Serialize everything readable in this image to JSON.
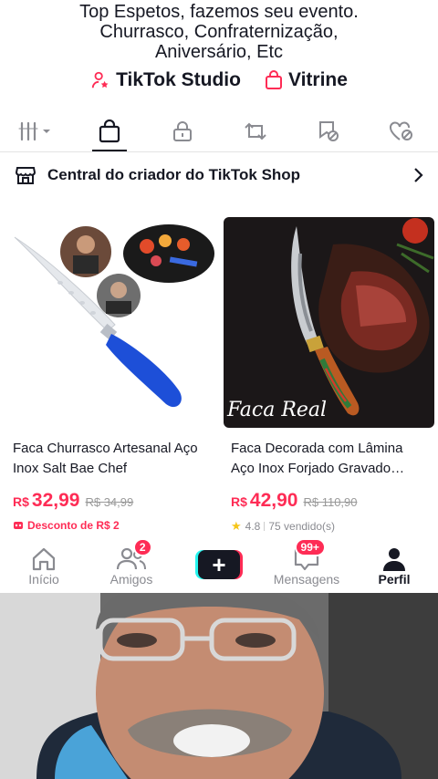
{
  "profile": {
    "bio_lines": [
      "Top Espetos, fazemos seu evento.",
      "Churrasco, Confraternização,",
      "Aniversário, Etc"
    ],
    "links": [
      {
        "icon": "person-star-icon",
        "label": "TikTok Studio"
      },
      {
        "icon": "shopping-bag-icon",
        "label": "Vitrine"
      }
    ]
  },
  "tabs": [
    {
      "icon": "grid-icon",
      "active": false
    },
    {
      "icon": "shopping-bag-icon",
      "active": true
    },
    {
      "icon": "lock-icon",
      "active": false
    },
    {
      "icon": "repost-icon",
      "active": false
    },
    {
      "icon": "bookmark-hidden-icon",
      "active": false
    },
    {
      "icon": "liked-hidden-icon",
      "active": false
    }
  ],
  "shop": {
    "title": "Central do criador do TikTok Shop",
    "icon": "store-icon"
  },
  "products": [
    {
      "name": "Faca Churrasco Artesanal Aço Inox Salt Bae Chef",
      "currency": "R$",
      "price": "32,99",
      "old_price": "R$ 34,99",
      "promo": "Desconto de R$ 2"
    },
    {
      "name": "Faca Decorada com Lâmina Aço Inox Forjado Gravado…",
      "currency": "R$",
      "price": "42,90",
      "old_price": "R$ 110,90",
      "rating": "4.8",
      "sold": "75 vendido(s)",
      "watermark": "Faca Real"
    }
  ],
  "nav": {
    "items": [
      {
        "label": "Início",
        "icon": "home-icon"
      },
      {
        "label": "Amigos",
        "icon": "friends-icon",
        "badge": "2"
      },
      {
        "label": "",
        "icon": "create-plus-icon"
      },
      {
        "label": "Mensagens",
        "icon": "inbox-icon",
        "badge": "99+"
      },
      {
        "label": "Perfil",
        "icon": "profile-icon",
        "active": true
      }
    ]
  },
  "colors": {
    "accent": "#fe2c55",
    "text": "#161823",
    "muted": "#8a8b91",
    "cyan": "#25f4ee"
  }
}
